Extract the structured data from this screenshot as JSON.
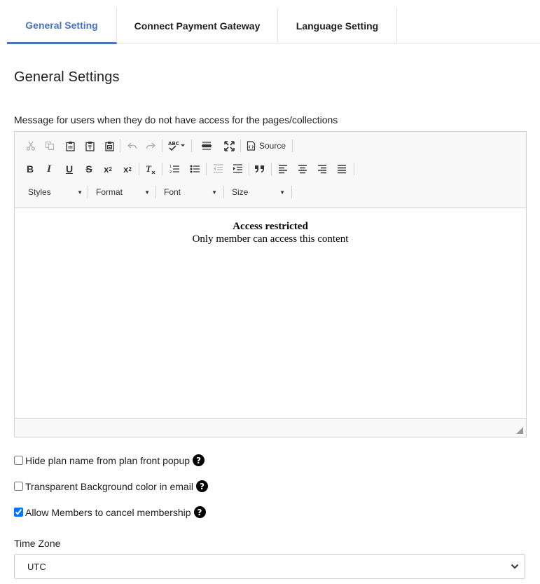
{
  "tabs": [
    {
      "label": "General Setting",
      "active": true
    },
    {
      "label": "Connect Payment Gateway",
      "active": false
    },
    {
      "label": "Language Setting",
      "active": false
    }
  ],
  "page": {
    "title": "General Settings",
    "message_label": "Message for users when they do not have access for the pages/collections"
  },
  "editor": {
    "source_label": "Source",
    "styles_label": "Styles",
    "format_label": "Format",
    "font_label": "Font",
    "size_label": "Size",
    "content_title": "Access restricted",
    "content_body": "Only member can access this content"
  },
  "options": [
    {
      "label": "Hide plan name from plan front popup",
      "checked": false
    },
    {
      "label": "Transparent Background color in email",
      "checked": false
    },
    {
      "label": "Allow Members to cancel membership",
      "checked": true
    }
  ],
  "timezone": {
    "label": "Time Zone",
    "value": "UTC"
  },
  "colors": {
    "accent": "#4a73c4",
    "help_icon": "#000000"
  }
}
